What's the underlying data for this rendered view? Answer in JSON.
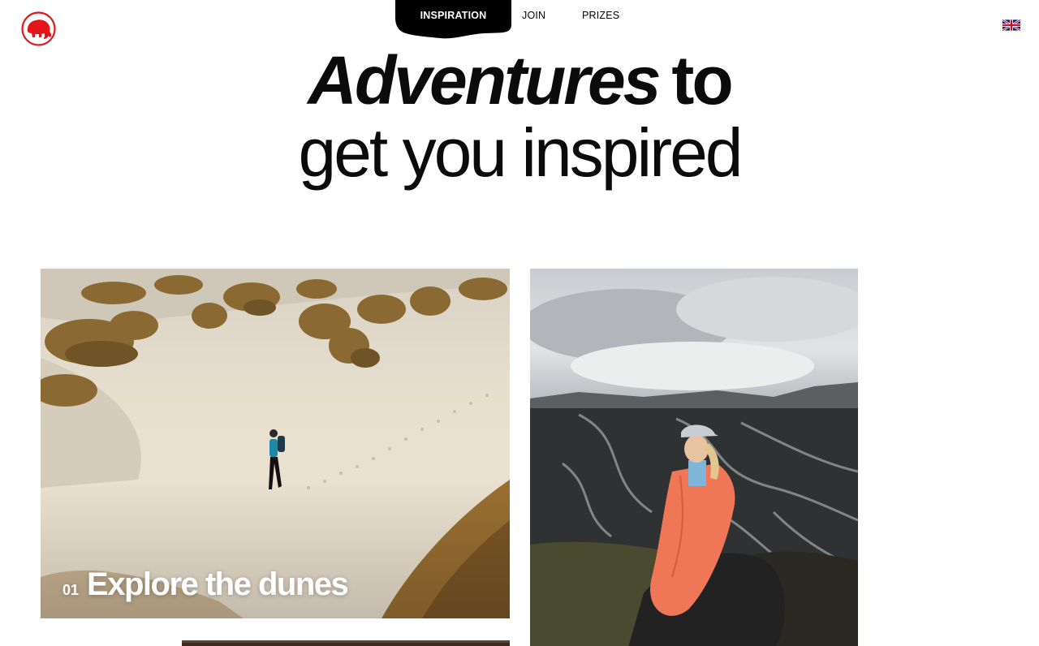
{
  "brand": {
    "logo_icon": "mammoth-logo-icon",
    "color": "#e3141a"
  },
  "nav": {
    "items": [
      {
        "label": "INSPIRATION",
        "active": true
      },
      {
        "label": "JOIN",
        "active": false
      },
      {
        "label": "PRIZES",
        "active": false
      }
    ],
    "active_bg": "#000000"
  },
  "language": {
    "icon": "uk-flag-icon"
  },
  "hero": {
    "title_italic": "Adventures",
    "title_rest": "to",
    "title_line2": "get you inspired"
  },
  "cards": [
    {
      "number": "01",
      "title": "Explore the dunes"
    },
    {
      "number": "",
      "title": ""
    },
    {
      "number": "",
      "title": ""
    }
  ]
}
